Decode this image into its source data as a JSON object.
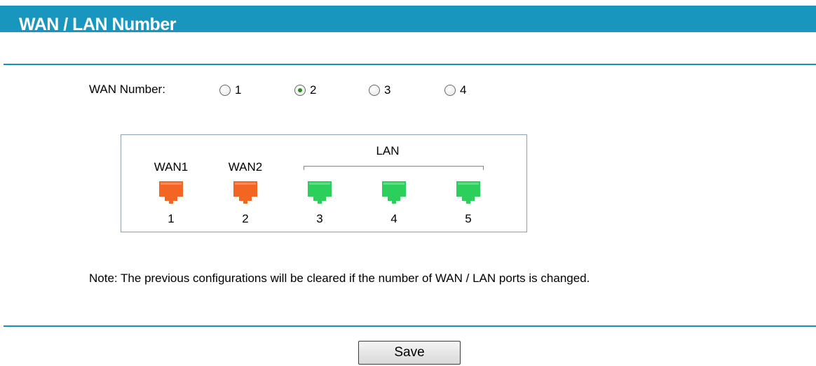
{
  "header": {
    "title": "WAN / LAN Number"
  },
  "wan_number": {
    "label": "WAN Number:",
    "options": [
      {
        "label": "1",
        "checked": false
      },
      {
        "label": "2",
        "checked": true
      },
      {
        "label": "3",
        "checked": false
      },
      {
        "label": "4",
        "checked": false
      }
    ]
  },
  "diagram": {
    "lan_title": "LAN",
    "ports": [
      {
        "name": "WAN1",
        "number": "1",
        "type": "wan",
        "color": "#f26522"
      },
      {
        "name": "WAN2",
        "number": "2",
        "type": "wan",
        "color": "#f26522"
      },
      {
        "name": "",
        "number": "3",
        "type": "lan",
        "color": "#2dcf5c"
      },
      {
        "name": "",
        "number": "4",
        "type": "lan",
        "color": "#2dcf5c"
      },
      {
        "name": "",
        "number": "5",
        "type": "lan",
        "color": "#2dcf5c"
      }
    ]
  },
  "note": "Note: The previous configurations will be cleared if the number of WAN / LAN ports is changed.",
  "actions": {
    "save_label": "Save"
  },
  "colors": {
    "header_bg": "#1996bd",
    "rule": "#1a8fb8"
  }
}
